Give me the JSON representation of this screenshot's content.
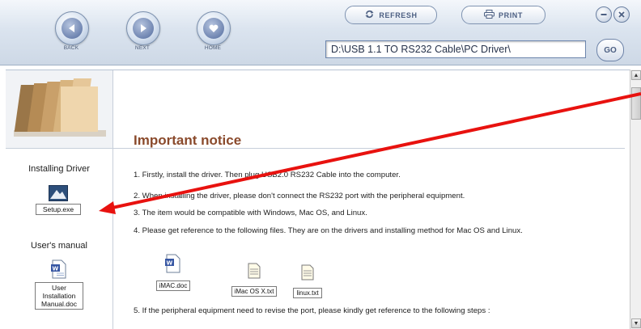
{
  "nav": {
    "back_label": "BACK",
    "next_label": "NEXT",
    "home_label": "HOME"
  },
  "toolbar": {
    "refresh_label": "REFRESH",
    "print_label": "PRINT",
    "path_value": "D:\\USB 1.1 TO RS232 Cable\\PC Driver\\",
    "go_label": "GO"
  },
  "sidebar": {
    "installing_driver_heading": "Installing Driver",
    "setup_file": "Setup.exe",
    "users_manual_heading": "User's manual",
    "manual_file_line1": "User",
    "manual_file_line2": "Installation",
    "manual_file_line3": "Manual.doc"
  },
  "main": {
    "title": "Important notice",
    "step1": "1. Firstly, install the driver. Then plug USB2.0 RS232 Cable into the computer.",
    "step2": "2. When installing the driver, please don't connect the RS232 port with the peripheral equipment.",
    "step3": "3. The item would be compatible with Windows, Mac OS, and Linux.",
    "step4": "4. Please get reference to the following files. They are on the drivers and installing method for Mac OS and Linux.",
    "files": [
      "iMAC.doc",
      "iMac OS X.txt",
      "linux.txt"
    ],
    "step5": "5. If the peripheral equipment need to revise the port, please kindly get reference to the following steps :"
  },
  "colors": {
    "title": "#8a4a2c",
    "annotation_arrow": "#e8120f",
    "toolbar_accent": "#4c5f82"
  },
  "icons": [
    "back-icon",
    "next-icon",
    "home-heart-icon",
    "refresh-icon",
    "printer-icon",
    "minimize-icon",
    "close-icon",
    "folders-icon",
    "setup-icon",
    "word-doc-icon",
    "text-file-icon"
  ]
}
